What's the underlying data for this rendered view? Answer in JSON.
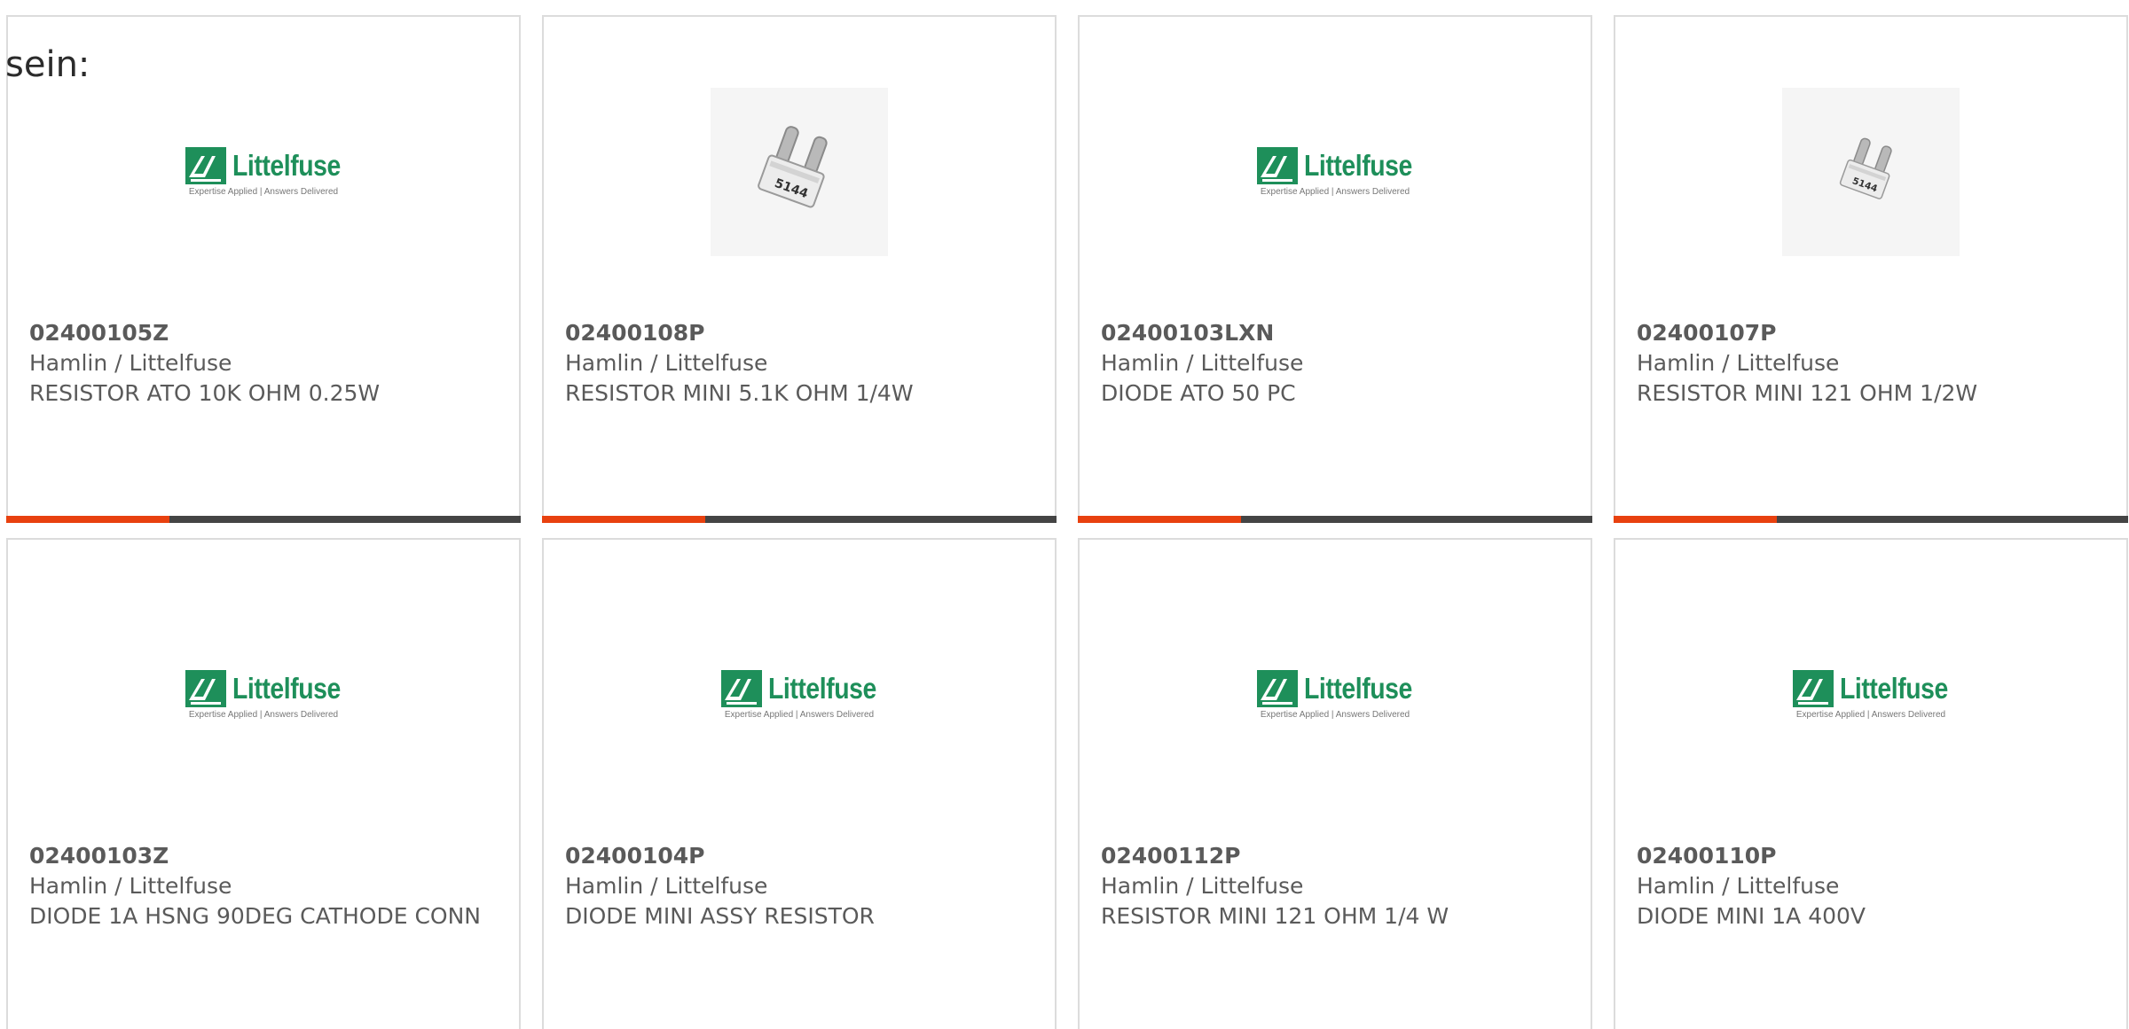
{
  "intro_text": "sein:",
  "logo": {
    "word": "Littelfuse",
    "tagline": "Expertise Applied | Answers Delivered"
  },
  "colors": {
    "accent": "#e8410f",
    "bar": "#444444",
    "logo_green": "#1e8f5a",
    "border": "#dcdcdc"
  },
  "products": [
    {
      "part": "02400105Z",
      "manufacturer": "Hamlin / Littelfuse",
      "description": "RESISTOR ATO 10K OHM 0.25W",
      "image": "littelfuse-logo",
      "bar": true
    },
    {
      "part": "02400108P",
      "manufacturer": "Hamlin / Littelfuse",
      "description": "RESISTOR MINI 5.1K OHM 1/4W",
      "image": "mini-component-photo",
      "bar": true
    },
    {
      "part": "02400103LXN",
      "manufacturer": "Hamlin / Littelfuse",
      "description": "DIODE ATO 50 PC",
      "image": "littelfuse-logo",
      "bar": true
    },
    {
      "part": "02400107P",
      "manufacturer": "Hamlin / Littelfuse",
      "description": "RESISTOR MINI 121 OHM 1/2W",
      "image": "mini-component-photo",
      "bar": true
    },
    {
      "part": "02400103Z",
      "manufacturer": "Hamlin / Littelfuse",
      "description": "DIODE 1A HSNG 90DEG CATHODE CONN",
      "image": "littelfuse-logo",
      "bar": false
    },
    {
      "part": "02400104P",
      "manufacturer": "Hamlin / Littelfuse",
      "description": "DIODE MINI ASSY RESISTOR",
      "image": "littelfuse-logo",
      "bar": false
    },
    {
      "part": "02400112P",
      "manufacturer": "Hamlin / Littelfuse",
      "description": "RESISTOR MINI 121 OHM 1/4 W",
      "image": "littelfuse-logo",
      "bar": false
    },
    {
      "part": "02400110P",
      "manufacturer": "Hamlin / Littelfuse",
      "description": "DIODE MINI 1A 400V",
      "image": "littelfuse-logo",
      "bar": false
    }
  ]
}
